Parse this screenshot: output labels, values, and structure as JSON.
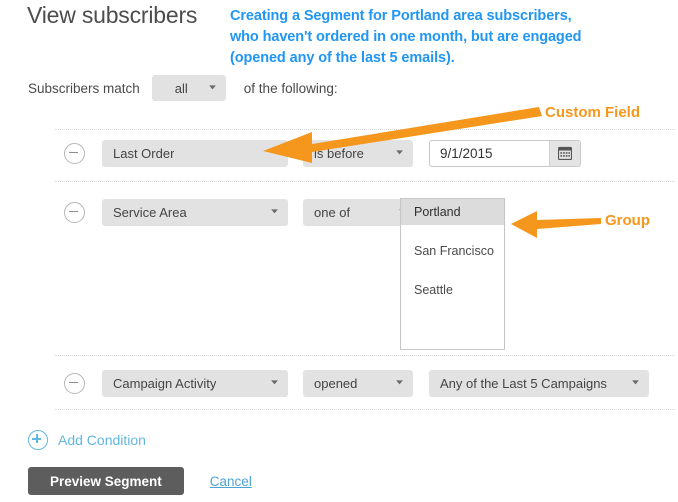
{
  "page": {
    "title": "View subscribers"
  },
  "annotations": {
    "description_lines": [
      "Creating a Segment for Portland area subscribers,",
      "who haven't ordered in one month, but are engaged",
      "(opened any of the last 5 emails)."
    ],
    "description_color": "#2196f3",
    "callouts": [
      {
        "label": "Custom Field",
        "color": "#f5971d",
        "points_to": "last-order-field-select"
      },
      {
        "label": "Group",
        "color": "#f5971d",
        "points_to": "service-area-listbox"
      }
    ]
  },
  "match": {
    "prefix": "Subscribers match",
    "selected": "all",
    "suffix": "of the following:",
    "chevron": "chevron-down-icon"
  },
  "conditions": [
    {
      "remove_icon": "minus-circle-icon",
      "field": "Last Order",
      "field_has_chevron": false,
      "operator": "is before",
      "value_type": "date",
      "value": "9/1/2015",
      "calendar_icon": "calendar-icon"
    },
    {
      "remove_icon": "minus-circle-icon",
      "field": "Service Area",
      "field_has_chevron": true,
      "operator": "one of",
      "value_type": "listbox",
      "options": [
        "Portland",
        "San Francisco",
        "Seattle"
      ],
      "selected_options": [
        "Portland"
      ]
    },
    {
      "remove_icon": "minus-circle-icon",
      "field": "Campaign Activity",
      "field_has_chevron": true,
      "operator": "opened",
      "value_type": "select",
      "value": "Any of the Last 5 Campaigns"
    }
  ],
  "add_condition": {
    "icon": "plus-circle-icon",
    "label": "Add Condition",
    "color": "#62b7e0"
  },
  "footer": {
    "primary_label": "Preview Segment",
    "primary_color": "#5d5d5d",
    "cancel_label": "Cancel",
    "cancel_color": "#4fa3d1"
  }
}
